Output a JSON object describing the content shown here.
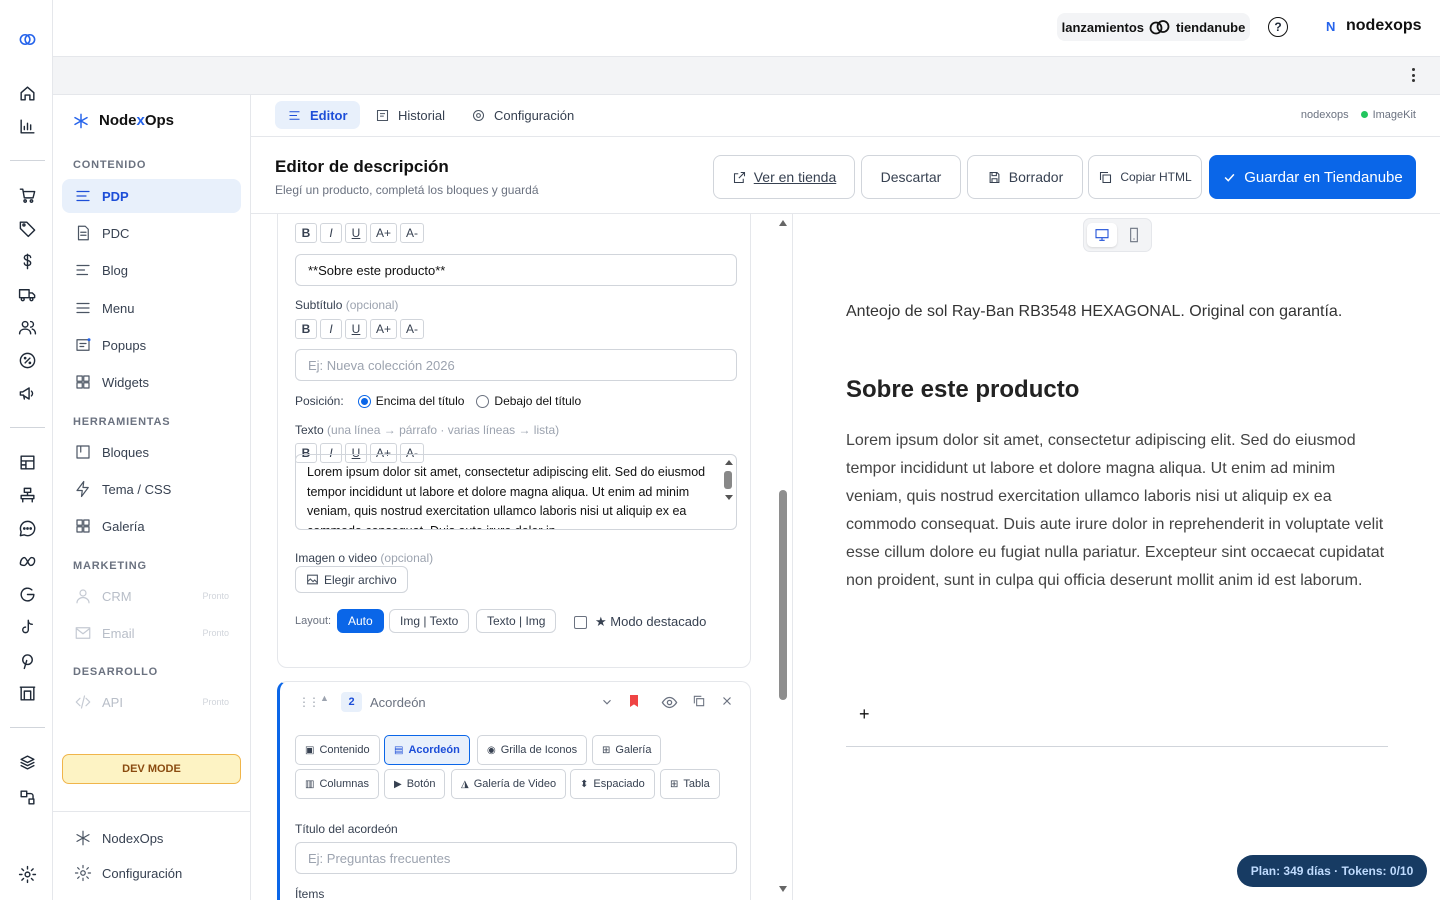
{
  "topbar": {
    "promo_left": "lanzamientos",
    "promo_right": "tiendanube",
    "help": "?",
    "user_initial": "N",
    "user": "nodexops"
  },
  "sidebar": {
    "brand_pre": "Node",
    "brand_x": "x",
    "brand_post": "Ops",
    "section_contenido": "CONTENIDO",
    "section_herramientas": "HERRAMIENTAS",
    "section_marketing": "MARKETING",
    "section_desarrollo": "DESARROLLO",
    "items": {
      "pdp": "PDP",
      "pdc": "PDC",
      "blog": "Blog",
      "menu": "Menu",
      "popups": "Popups",
      "widgets": "Widgets",
      "bloques": "Bloques",
      "tema": "Tema / CSS",
      "galeria": "Galería",
      "crm": "CRM",
      "email": "Email",
      "api": "API"
    },
    "soon": "Pronto",
    "dev_mode": "DEV MODE",
    "footer_brand": "NodexOps",
    "footer_config": "Configuración"
  },
  "tabs": {
    "editor": "Editor",
    "historial": "Historial",
    "config": "Configuración",
    "account": "nodexops",
    "integration": "ImageKit"
  },
  "header": {
    "title": "Editor de descripción",
    "subtitle": "Elegí un producto, completá los bloques y guardá",
    "ver_tienda": "Ver en tienda",
    "descartar": "Descartar",
    "borrador": "Borrador",
    "copiar": "Copiar HTML",
    "guardar": "Guardar en Tiendanube"
  },
  "block1": {
    "fmt": [
      "B",
      "I",
      "U",
      "A+",
      "A-"
    ],
    "title_value": "**Sobre este producto**",
    "subtitle_label": "Subtítulo",
    "optional": "(opcional)",
    "subtitle_placeholder": "Ej: Nueva colección 2026",
    "position_label": "Posición:",
    "position_above": "Encima del título",
    "position_below": "Debajo del título",
    "text_label": "Texto",
    "text_hint": "(una línea → párrafo · varias líneas → lista)",
    "text_value": "Lorem ipsum dolor sit amet, consectetur adipiscing elit. Sed do eiusmod tempor incididunt ut labore et dolore magna aliqua. Ut enim ad minim veniam, quis nostrud exercitation ullamco laboris nisi ut aliquip ex ea commodo consequat. Duis aute irure dolor in",
    "image_label": "Imagen o video",
    "image_button": "Elegir archivo",
    "layout_label": "Layout:",
    "layout_options": [
      "Auto",
      "Img | Texto",
      "Texto | Img"
    ],
    "highlight": "★ Modo destacado"
  },
  "block2": {
    "number": "2",
    "name": "Acordeón",
    "types": [
      "Contenido",
      "Acordeón",
      "Grilla de Iconos",
      "Galería",
      "Columnas",
      "Botón",
      "Galería de Video",
      "Espaciado",
      "Tabla"
    ],
    "accordion_title_label": "Título del acordeón",
    "accordion_title_placeholder": "Ej: Preguntas frecuentes",
    "items_label": "Ítems"
  },
  "preview": {
    "lead": "Anteojo de sol Ray-Ban RB3548 HEXAGONAL. Original con garantía.",
    "heading": "Sobre este producto",
    "body": "Lorem ipsum dolor sit amet, consectetur adipiscing elit. Sed do eiusmod tempor incididunt ut labore et dolore magna aliqua. Ut enim ad minim veniam, quis nostrud exercitation ullamco laboris nisi ut aliquip ex ea commodo consequat. Duis aute irure dolor in reprehenderit in voluptate velit esse cillum dolore eu fugiat nulla pariatur. Excepteur sint occaecat cupidatat non proident, sunt in culpa qui officia deserunt mollit anim id est laborum.",
    "plus": "+"
  },
  "plan": "Plan: 349 días · Tokens: 0/10",
  "colors": {
    "accent": "#0a66e8",
    "active_bg": "#e8f0fb",
    "dev_mode_bg": "#fdf3c4",
    "plan_bg": "#173b63"
  }
}
